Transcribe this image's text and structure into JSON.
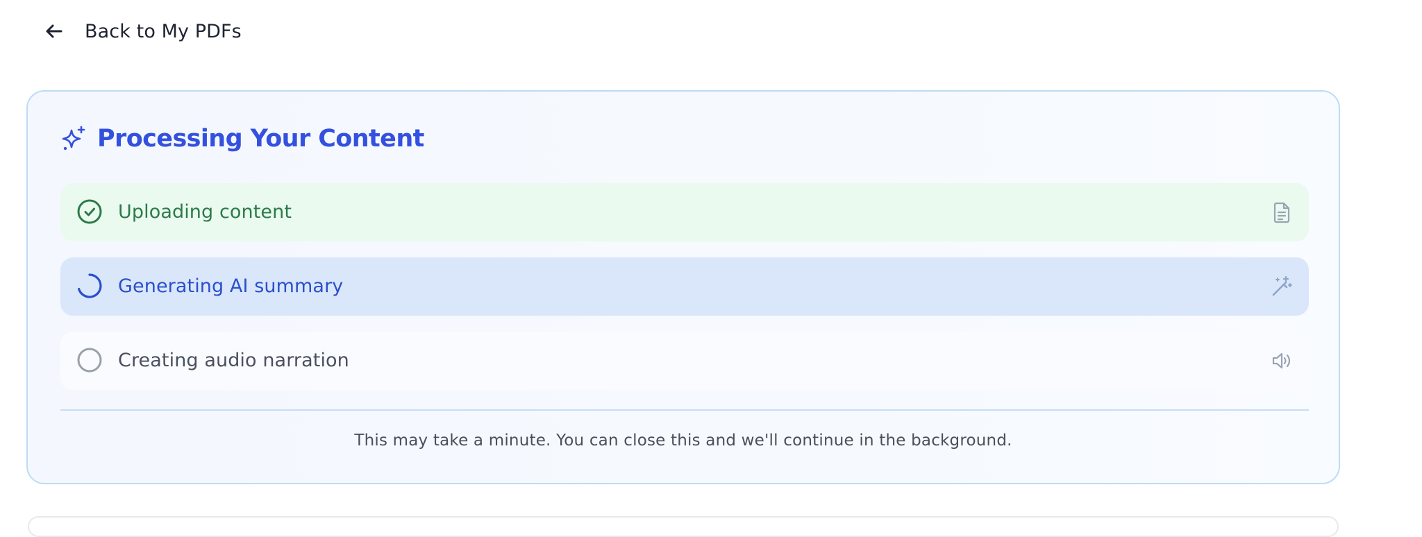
{
  "nav": {
    "back_label": "Back to My PDFs",
    "back_icon": "arrow-left-icon"
  },
  "processing": {
    "title": "Processing Your Content",
    "title_icon": "sparkles-icon",
    "accent_color": "#3450df",
    "steps": [
      {
        "label": "Uploading content",
        "status": "done",
        "status_icon": "check-circle-icon",
        "trail_icon": "document-icon",
        "color": "#2c7a4a"
      },
      {
        "label": "Generating AI summary",
        "status": "in-progress",
        "status_icon": "spinner-icon",
        "trail_icon": "magic-wand-icon",
        "color": "#2a4fcd"
      },
      {
        "label": "Creating audio narration",
        "status": "pending",
        "status_icon": "empty-circle-icon",
        "trail_icon": "speaker-icon",
        "color": "#4a5060"
      }
    ],
    "note": "This may take a minute. You can close this and we'll continue in the background."
  }
}
